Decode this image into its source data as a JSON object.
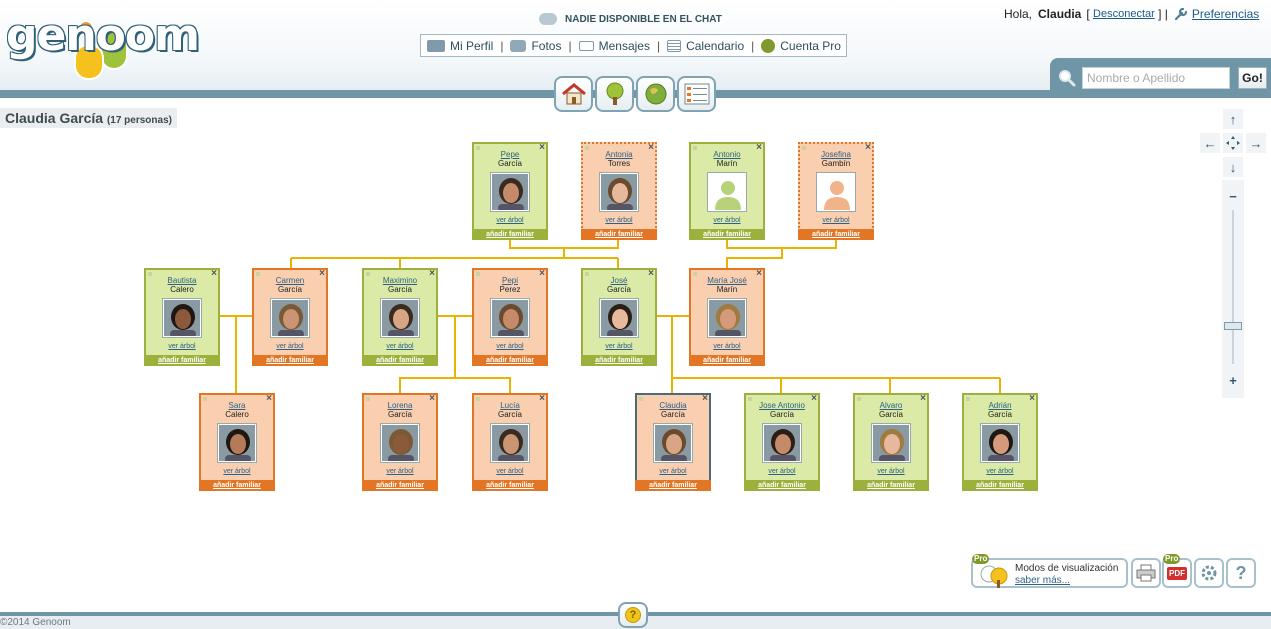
{
  "app": {
    "logo_text": "genoom",
    "copyright": "©2014 Genoom"
  },
  "chat": {
    "status": "NADIE DISPONIBLE EN EL CHAT"
  },
  "menu": {
    "items": [
      {
        "label": "Mi Perfil",
        "icon": "profile-icon"
      },
      {
        "label": "Fotos",
        "icon": "camera-icon"
      },
      {
        "label": "Mensajes",
        "icon": "envelope-icon"
      },
      {
        "label": "Calendario",
        "icon": "calendar-icon"
      },
      {
        "label": "Cuenta Pro",
        "icon": "gear-badge-icon"
      }
    ],
    "separator": "|"
  },
  "user": {
    "greeting": "Hola,",
    "name": "Claudia",
    "logout": "Desconectar",
    "preferences": "Preferencias"
  },
  "search": {
    "placeholder": "Nombre o Apellido",
    "go": "Go!"
  },
  "tree": {
    "owner": "Claudia García",
    "count": "(17 personas)"
  },
  "cards": {
    "view_tree": "ver árbol",
    "add_family": "añadir familiar"
  },
  "persons": [
    {
      "first": "Pepe",
      "last": "García",
      "gender": "m"
    },
    {
      "first": "Antonia",
      "last": "Torres",
      "gender": "f"
    },
    {
      "first": "Antonio",
      "last": "Marín",
      "gender": "m"
    },
    {
      "first": "Josefina",
      "last": "Gambín",
      "gender": "f"
    },
    {
      "first": "Bautista",
      "last": "Calero",
      "gender": "m"
    },
    {
      "first": "Carmen",
      "last": "García",
      "gender": "f"
    },
    {
      "first": "Maximino",
      "last": "García",
      "gender": "m"
    },
    {
      "first": "Pepi",
      "last": "Perez",
      "gender": "f"
    },
    {
      "first": "José",
      "last": "García",
      "gender": "m"
    },
    {
      "first": "María José",
      "last": "Marín",
      "gender": "f"
    },
    {
      "first": "Sara",
      "last": "Calero",
      "gender": "f"
    },
    {
      "first": "Lorena",
      "last": "García",
      "gender": "f"
    },
    {
      "first": "Lucía",
      "last": "García",
      "gender": "f"
    },
    {
      "first": "Claudia",
      "last": "García",
      "gender": "f"
    },
    {
      "first": "Jose Antonio",
      "last": "García",
      "gender": "m"
    },
    {
      "first": "Alvaro",
      "last": "García",
      "gender": "m"
    },
    {
      "first": "Adrián",
      "last": "García",
      "gender": "m"
    }
  ],
  "tools": {
    "modes_title": "Modos de visualización",
    "modes_link": "saber más...",
    "pro_badge": "Pro",
    "pdf_label": "PDF",
    "help": "?"
  },
  "nav": {
    "up": "↑",
    "down": "↓",
    "left": "←",
    "right": "→",
    "zoom_in": "+",
    "zoom_out": "−",
    "zoom_level": 0.25
  },
  "colors": {
    "male": "#dbeaa6",
    "female": "#f9cfb0",
    "line": "#e8b400",
    "brand": "#6f95a6"
  }
}
